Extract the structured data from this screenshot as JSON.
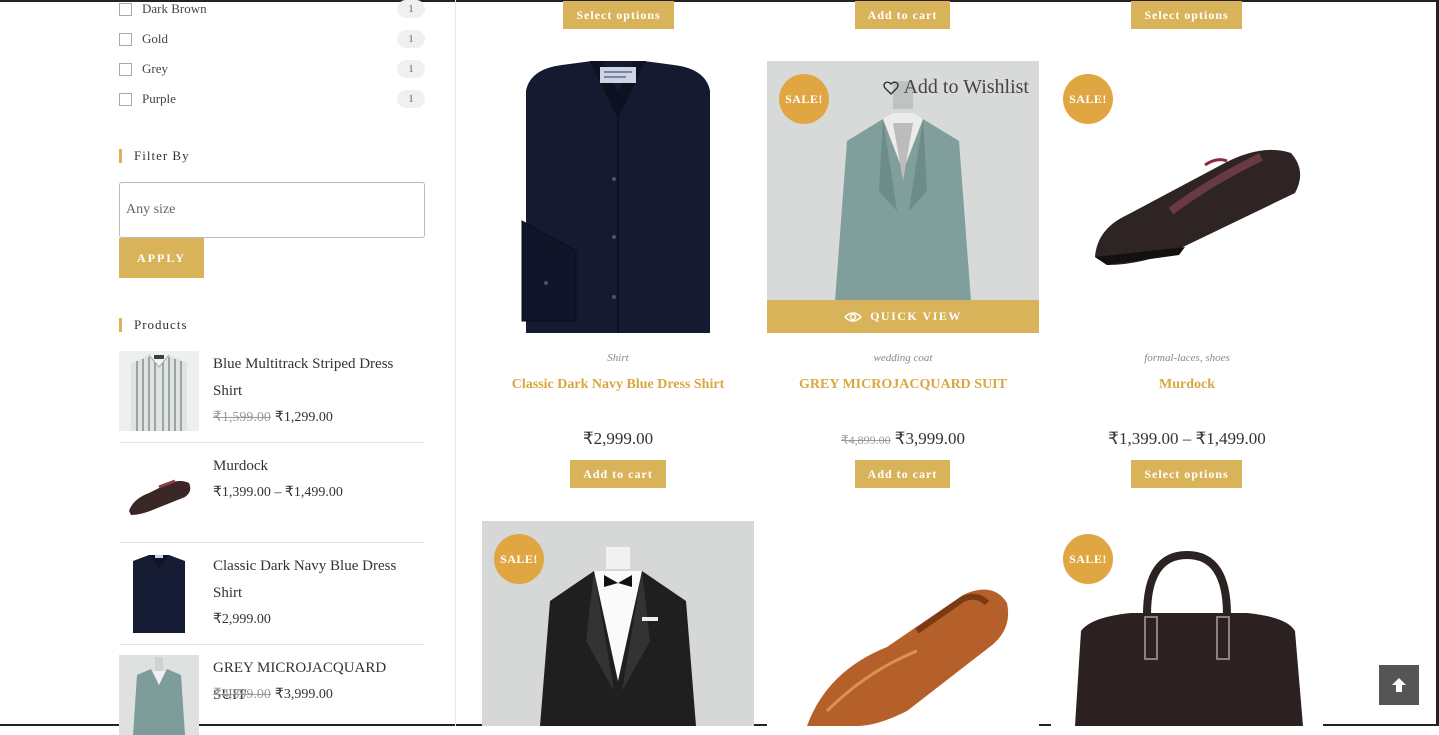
{
  "sidebar": {
    "colors": [
      {
        "label": "Dark Brown",
        "count": "1"
      },
      {
        "label": "Gold",
        "count": "1"
      },
      {
        "label": "Grey",
        "count": "1"
      },
      {
        "label": "Purple",
        "count": "1"
      }
    ],
    "filter_title": "Filter By",
    "size_placeholder": "Any size",
    "apply_label": "APPLY",
    "products_title": "Products",
    "products": [
      {
        "name": "Blue Multitrack Striped Dress Shirt",
        "old_price": "₹1,599.00",
        "price": "₹1,299.00"
      },
      {
        "name": "Murdock",
        "old_price": "",
        "price": "₹1,399.00 – ₹1,499.00"
      },
      {
        "name": "Classic Dark Navy Blue Dress Shirt",
        "old_price": "",
        "price": "₹2,999.00"
      },
      {
        "name": "GREY MICROJACQUARD SUIT",
        "old_price": "₹4,899.00",
        "price": "₹3,999.00"
      }
    ]
  },
  "top_buttons": [
    "Select options",
    "Add to cart",
    "Select options"
  ],
  "grid": [
    {
      "category": "Shirt",
      "category2": "",
      "title": "Classic Dark Navy Blue Dress Shirt",
      "old_price": "",
      "price": "₹2,999.00",
      "button": "Add to cart",
      "sale": ""
    },
    {
      "category": "wedding coat",
      "category2": "",
      "title": "GREY MICROJACQUARD SUIT",
      "old_price": "₹4,899.00",
      "price": "₹3,999.00",
      "button": "Add to cart",
      "sale": "SALE!",
      "wishlist": "Add to Wishlist",
      "quick_view": "QUICK VIEW"
    },
    {
      "category": "formal-laces",
      "category2": "shoes",
      "title": "Murdock",
      "old_price": "",
      "price": "₹1,399.00 – ₹1,499.00",
      "button": "Select options",
      "sale": "SALE!"
    }
  ],
  "bottom_row_sale": [
    "SALE!",
    "",
    "SALE!"
  ],
  "colors": {
    "accent": "#d9b35a",
    "sale_badge": "#dfa642",
    "title": "#d9a740"
  }
}
